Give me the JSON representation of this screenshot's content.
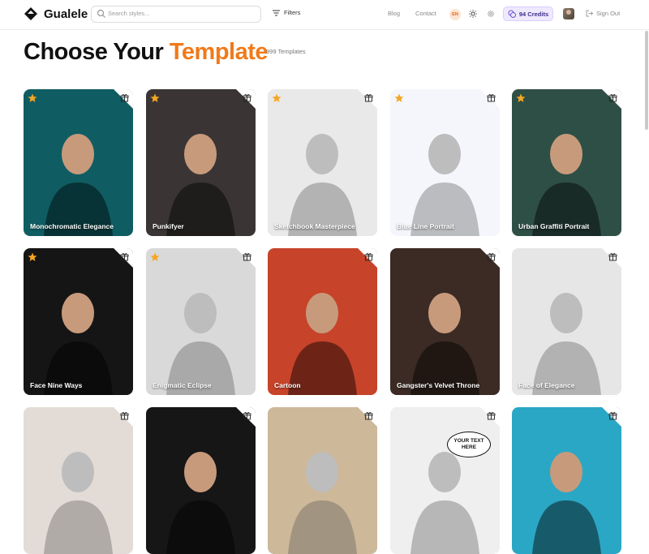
{
  "header": {
    "brand": "Gualele",
    "search_placeholder": "Search styles...",
    "filters_label": "Filters",
    "nav_blog": "Blog",
    "nav_contact": "Contact",
    "language": "EN",
    "credits": "94 Credits",
    "sign_out": "Sign Out"
  },
  "page": {
    "title_part1": "Choose Your",
    "title_part2": "Template",
    "template_count": "999 Templates"
  },
  "templates": [
    {
      "name": "Monochromatic Elegance",
      "starred": true,
      "bg": "#0f5d63"
    },
    {
      "name": "Punkifyer",
      "starred": true,
      "bg": "#3a3534"
    },
    {
      "name": "Sketchbook Masterpiece",
      "starred": true,
      "bg": "#e9e9e9"
    },
    {
      "name": "Blue Line Portrait",
      "starred": true,
      "bg": "#f4f6fb"
    },
    {
      "name": "Urban Graffiti Portrait",
      "starred": true,
      "bg": "#2e4f45"
    },
    {
      "name": "Face Nine Ways",
      "starred": true,
      "bg": "#151515"
    },
    {
      "name": "Enigmatic Eclipse",
      "starred": true,
      "bg": "#d9d9d9"
    },
    {
      "name": "Cartoon",
      "starred": false,
      "bg": "#c7432a"
    },
    {
      "name": "Gangster's Velvet Throne",
      "starred": false,
      "bg": "#3b2b24"
    },
    {
      "name": "Face of Elegance",
      "starred": false,
      "bg": "#e6e6e6"
    },
    {
      "name": "",
      "starred": false,
      "bg": "#e3dcd6"
    },
    {
      "name": "",
      "starred": false,
      "bg": "#161616"
    },
    {
      "name": "",
      "starred": false,
      "bg": "#cdb89a"
    },
    {
      "name": "",
      "starred": false,
      "bg": "#efefef",
      "speech": "YOUR TEXT HERE"
    },
    {
      "name": "",
      "starred": false,
      "bg": "#2aa7c4"
    }
  ],
  "colors": {
    "accent": "#f07a1a",
    "star": "#f5a623",
    "credits_bg": "#efe9ff"
  }
}
